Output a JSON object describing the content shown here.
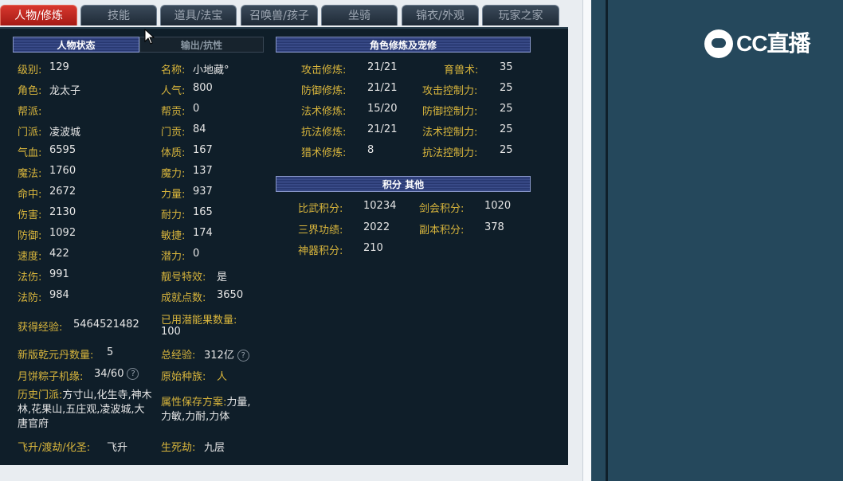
{
  "tabs": [
    "人物/修炼",
    "技能",
    "道具/法宝",
    "召唤兽/孩子",
    "坐骑",
    "锦衣/外观",
    "玩家之家"
  ],
  "headers": {
    "status": "人物状态",
    "resist": "输出/抗性",
    "cultivation": "角色修炼及宠修",
    "points": "积分 其他"
  },
  "stats_left": [
    {
      "label": "级别:",
      "value": "129"
    },
    {
      "label": "角色:",
      "value": "龙太子"
    },
    {
      "label": "帮派:",
      "value": ""
    },
    {
      "label": "门派:",
      "value": "凌波城"
    },
    {
      "label": "气血:",
      "value": "6595"
    },
    {
      "label": "魔法:",
      "value": "1760"
    },
    {
      "label": "命中:",
      "value": "2672"
    },
    {
      "label": "伤害:",
      "value": "2130"
    },
    {
      "label": "防御:",
      "value": "1092"
    },
    {
      "label": "速度:",
      "value": "422"
    },
    {
      "label": "法伤:",
      "value": "991"
    },
    {
      "label": "法防:",
      "value": "984"
    }
  ],
  "stats_right": [
    {
      "label": "名称:",
      "value": "小地藏°"
    },
    {
      "label": "人气:",
      "value": "800"
    },
    {
      "label": "帮贡:",
      "value": "0"
    },
    {
      "label": "门贡:",
      "value": "84"
    },
    {
      "label": "体质:",
      "value": "167"
    },
    {
      "label": "魔力:",
      "value": "137"
    },
    {
      "label": "力量:",
      "value": "937"
    },
    {
      "label": "耐力:",
      "value": "165"
    },
    {
      "label": "敏捷:",
      "value": "174"
    },
    {
      "label": "潜力:",
      "value": "0"
    },
    {
      "label": "靓号特效:",
      "value": "是"
    },
    {
      "label": "成就点数:",
      "value": "3650"
    }
  ],
  "extra": {
    "exp_label": "获得经验:",
    "exp_value": "5464521482",
    "potion_label": "已用潜能果数量:",
    "potion_value": "100",
    "qianyuan_label": "新版乾元丹数量:",
    "qianyuan_value": "5",
    "total_exp_label": "总经验:",
    "total_exp_value": "312亿",
    "moon_label": "月饼粽子机缘:",
    "moon_value": "34/60",
    "race_label": "原始种族:",
    "race_value": "人",
    "history_label": "历史门派:",
    "history_value": "方寸山,化生寺,神木林,花果山,五庄观,凌波城,大唐官府",
    "attr_label": "属性保存方案:",
    "attr_value": "力量,力敏,力耐,力体",
    "fly_label": "飞升/渡劫/化圣:",
    "fly_value": "飞升",
    "life_label": "生死劫:",
    "life_value": "九层",
    "help_glyph": "?"
  },
  "cultivation_left": [
    {
      "label": "攻击修炼:",
      "value": "21/21"
    },
    {
      "label": "防御修炼:",
      "value": "21/21"
    },
    {
      "label": "法术修炼:",
      "value": "15/20"
    },
    {
      "label": "抗法修炼:",
      "value": "21/21"
    },
    {
      "label": "猎术修炼:",
      "value": "8"
    }
  ],
  "cultivation_right": [
    {
      "label": "育兽术:",
      "value": "35"
    },
    {
      "label": "攻击控制力:",
      "value": "25"
    },
    {
      "label": "防御控制力:",
      "value": "25"
    },
    {
      "label": "法术控制力:",
      "value": "25"
    },
    {
      "label": "抗法控制力:",
      "value": "25"
    }
  ],
  "points_rows": [
    {
      "l_label": "比武积分:",
      "l_value": "10234",
      "r_label": "剑会积分:",
      "r_value": "1020"
    },
    {
      "l_label": "三界功绩:",
      "l_value": "2022",
      "r_label": "副本积分:",
      "r_value": "378"
    },
    {
      "l_label": "神器积分:",
      "l_value": "210",
      "r_label": "",
      "r_value": ""
    }
  ],
  "logo_text": "CC直播",
  "colors": {
    "panel": "#0f1e29",
    "label": "#d8b53c",
    "active_tab": "#c0281f",
    "video_bg": "#25485c"
  }
}
